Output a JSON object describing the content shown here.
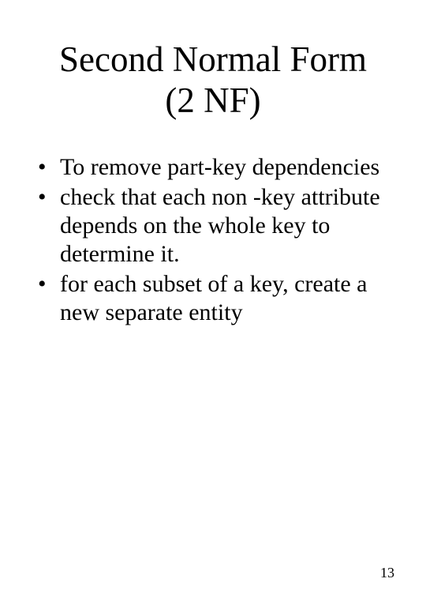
{
  "title_line1": "Second Normal Form",
  "title_line2": "(2 NF)",
  "bullets": [
    "To remove part-key dependencies",
    "check that each non -key attribute depends on the whole key to determine it.",
    "for each subset of a key, create a new separate entity"
  ],
  "page_number": "13"
}
